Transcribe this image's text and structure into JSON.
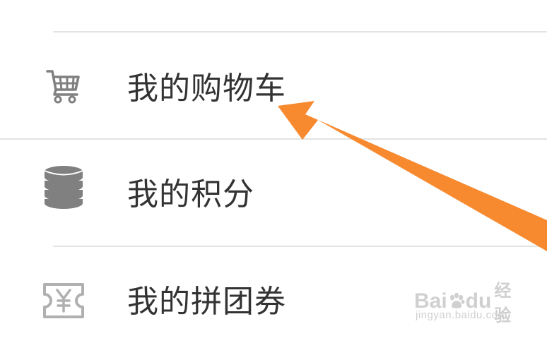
{
  "menu": {
    "items": [
      {
        "label": "我的购物车",
        "icon": "shopping-cart-icon"
      },
      {
        "label": "我的积分",
        "icon": "coins-stack-icon"
      },
      {
        "label": "我的拼团券",
        "icon": "yuan-coupon-icon"
      }
    ]
  },
  "watermark": {
    "logo_a": "Bai",
    "logo_b": "du",
    "logo_cn": "经验",
    "url": "jingyan.baidu.com"
  },
  "colors": {
    "label": "#333333",
    "icon": "#808080",
    "divider": "#e3e3e3",
    "arrow": "#f7892f",
    "background": "#ffffff"
  }
}
